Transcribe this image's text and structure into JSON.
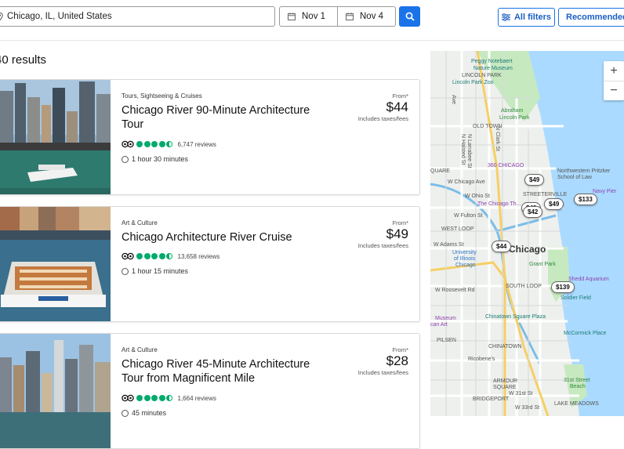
{
  "search": {
    "location_value": "Chicago, IL, United States",
    "date_start": "Nov 1",
    "date_end": "Nov 4"
  },
  "toolbar": {
    "filters_label": "All filters",
    "sort_label": "Recommended"
  },
  "results": {
    "count_text": "40 results"
  },
  "cards": [
    {
      "category": "Tours, Sightseeing & Cruises",
      "title": "Chicago River 90-Minute Architecture Tour",
      "rating_value": 4.5,
      "reviews": "6,747 reviews",
      "duration": "1 hour 30 minutes",
      "from_label": "From*",
      "price": "$44",
      "taxes_label": "Includes taxes/fees"
    },
    {
      "category": "Art & Culture",
      "title": "Chicago Architecture River Cruise",
      "rating_value": 4.5,
      "reviews": "13,658 reviews",
      "duration": "1 hour 15 minutes",
      "from_label": "From*",
      "price": "$49",
      "taxes_label": "Includes taxes/fees"
    },
    {
      "category": "Art & Culture",
      "title": "Chicago River 45-Minute Architecture Tour from Magnificent Mile",
      "rating_value": 4.5,
      "reviews": "1,664 reviews",
      "duration": "45 minutes",
      "from_label": "From*",
      "price": "$28",
      "taxes_label": "Includes taxes/fees"
    }
  ],
  "map": {
    "zoom_in": "+",
    "zoom_out": "−",
    "pins": [
      "$49",
      "$49",
      "$42",
      "$49",
      "$133",
      "$44",
      "$139"
    ],
    "labels": {
      "peggy": "Peggy Notebaert",
      "nature": "Nature Museum",
      "lincoln_park": "LINCOLN PARK",
      "lincoln_zoo": "Lincoln Park Zoo",
      "abraham": "Abraham",
      "lincoln_park_label": "Lincoln Park",
      "old_town": "OLD TOWN",
      "three60": "360 CHICAGO",
      "nw_pritzker": "Northwestern Pritzker",
      "school_of_law": "School of Law",
      "streeterville": "STREETERVILLE",
      "navy_pier": "Navy Pier",
      "chicago_theatre": "The Chicago Th...",
      "west_loop": "WEST LOOP",
      "chicago": "Chicago",
      "university": "University",
      "of_illinois": "of Illinois",
      "chicago_small": "Chicago",
      "grant_park": "Grant Park",
      "shedd": "Shedd Aquarium",
      "south_loop": "SOUTH LOOP",
      "soldier_field": "Soldier Field",
      "chinatown_sq": "Chinatown Square Plaza",
      "mccormick": "McCormick Place",
      "pilsen": "PILSEN",
      "chinatown": "CHINATOWN",
      "ricobene": "Ricobene's",
      "armour": "ARMOUR",
      "square": "SQUARE",
      "bridgeport": "BRIDGEPORT",
      "museum": "Museum",
      "can_art": "can Art",
      "quare": "QUARE",
      "thirty_first": "31st Street",
      "beach": "Beach",
      "lake_meadows": "LAKE MEADOWS",
      "w_ohio": "W Ohio St",
      "w_fulton": "W Fulton St",
      "w_adams": "W Adams St",
      "w_roosevelt": "W Roosevelt Rd",
      "w_31st": "W 31st St",
      "w_33rd": "W 33rd St",
      "w_chicago_ave": "W Chicago Ave",
      "n_halsted": "N Halsted St",
      "n_larrabee": "N Larrabee St",
      "ave": "Ave",
      "clark_st": "N Clark St"
    }
  },
  "colors": {
    "accent": "#1a73e8",
    "rating_green": "#00aa6c",
    "map_water": "#aadaff",
    "map_park": "#c7e9c0"
  }
}
